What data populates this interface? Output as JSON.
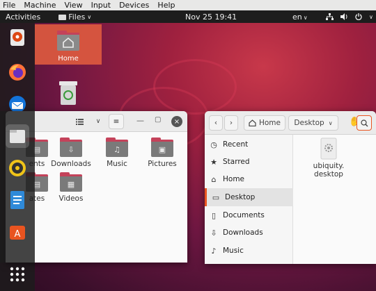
{
  "host_menu": [
    "File",
    "Machine",
    "View",
    "Input",
    "Devices",
    "Help"
  ],
  "topbar": {
    "activities": "Activities",
    "app_menu": "Files",
    "clock": "Nov 25  19:41",
    "language": "en"
  },
  "desktop_icons": [
    {
      "label": "Home",
      "icon": "home-folder-icon"
    },
    {
      "label": "",
      "icon": "trash-icon"
    }
  ],
  "left_window": {
    "folders": [
      {
        "label": "ents",
        "icon": "documents-folder-icon"
      },
      {
        "label": "Downloads",
        "icon": "downloads-folder-icon"
      },
      {
        "label": "Music",
        "icon": "music-folder-icon"
      },
      {
        "label": "Pictures",
        "icon": "pictures-folder-icon"
      },
      {
        "label": "ates",
        "icon": "templates-folder-icon"
      },
      {
        "label": "Videos",
        "icon": "videos-folder-icon"
      }
    ]
  },
  "right_window": {
    "breadcrumb": [
      "Home",
      "Desktop"
    ],
    "sidebar": [
      {
        "label": "Recent",
        "icon": "clock-icon"
      },
      {
        "label": "Starred",
        "icon": "star-icon"
      },
      {
        "label": "Home",
        "icon": "home-icon"
      },
      {
        "label": "Desktop",
        "icon": "desktop-icon"
      },
      {
        "label": "Documents",
        "icon": "document-icon"
      },
      {
        "label": "Downloads",
        "icon": "download-icon"
      },
      {
        "label": "Music",
        "icon": "music-icon"
      }
    ],
    "file": {
      "label": "ubiquity.\ndesktop",
      "icon": "settings-file-icon"
    }
  },
  "colors": {
    "accent": "#e95420",
    "folder_tab": "#c4425a"
  }
}
